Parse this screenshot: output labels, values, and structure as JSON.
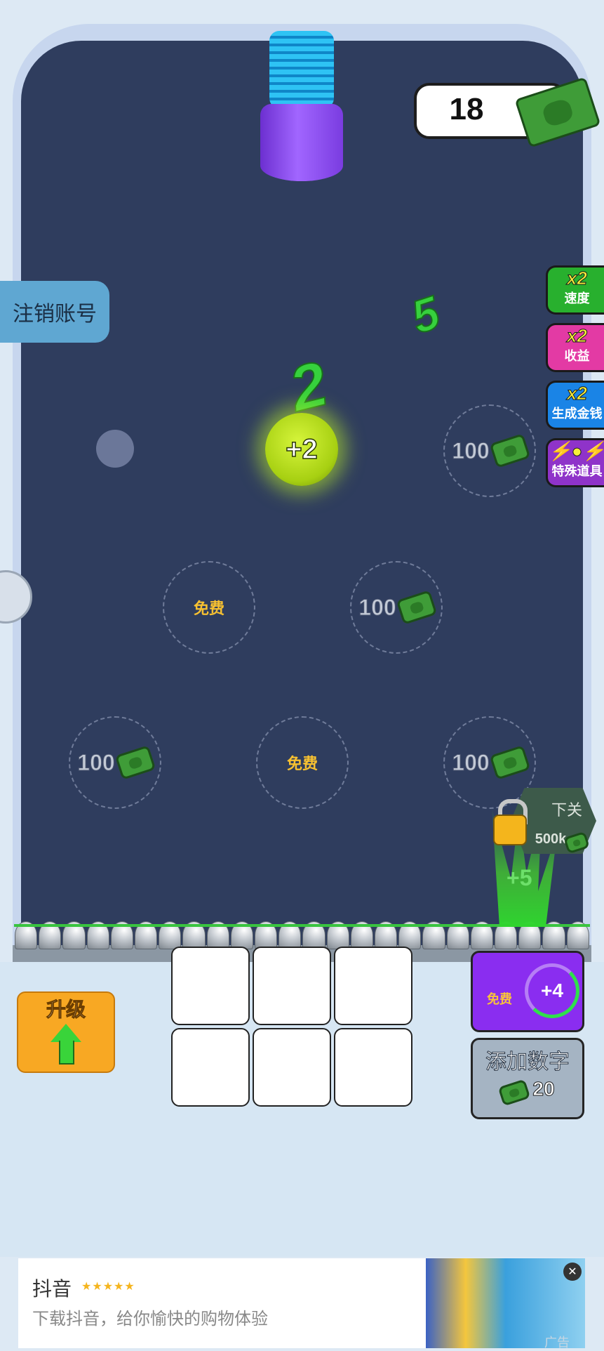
{
  "money": {
    "value": "18"
  },
  "account": {
    "cancel_label": "注销账号"
  },
  "side_buttons": [
    {
      "mult": "x2",
      "label": "速度"
    },
    {
      "mult": "x2",
      "label": "收益"
    },
    {
      "mult": "x2",
      "label": "生成金钱"
    },
    {
      "label": "特殊道具"
    }
  ],
  "board": {
    "floating_numbers": [
      "2",
      "5"
    ],
    "ball_label": "+2",
    "slots": [
      {
        "type": "cost",
        "value": "100"
      },
      {
        "type": "free",
        "label": "免费"
      },
      {
        "type": "cost",
        "value": "100"
      },
      {
        "type": "cost",
        "value": "100"
      },
      {
        "type": "free",
        "label": "免费"
      },
      {
        "type": "cost",
        "value": "100"
      }
    ],
    "next_level": {
      "label": "下关",
      "cost": "500k"
    },
    "plus_effect": "+5"
  },
  "controls": {
    "upgrade_label": "升级",
    "free_label": "免费",
    "free_amount": "+4",
    "add_number_label": "添加数字",
    "add_number_cost": "20"
  },
  "ad": {
    "title": "抖音",
    "stars": "★★★★★",
    "subtitle": "下载抖音，给你愉快的购物体验",
    "tag": "广告"
  }
}
